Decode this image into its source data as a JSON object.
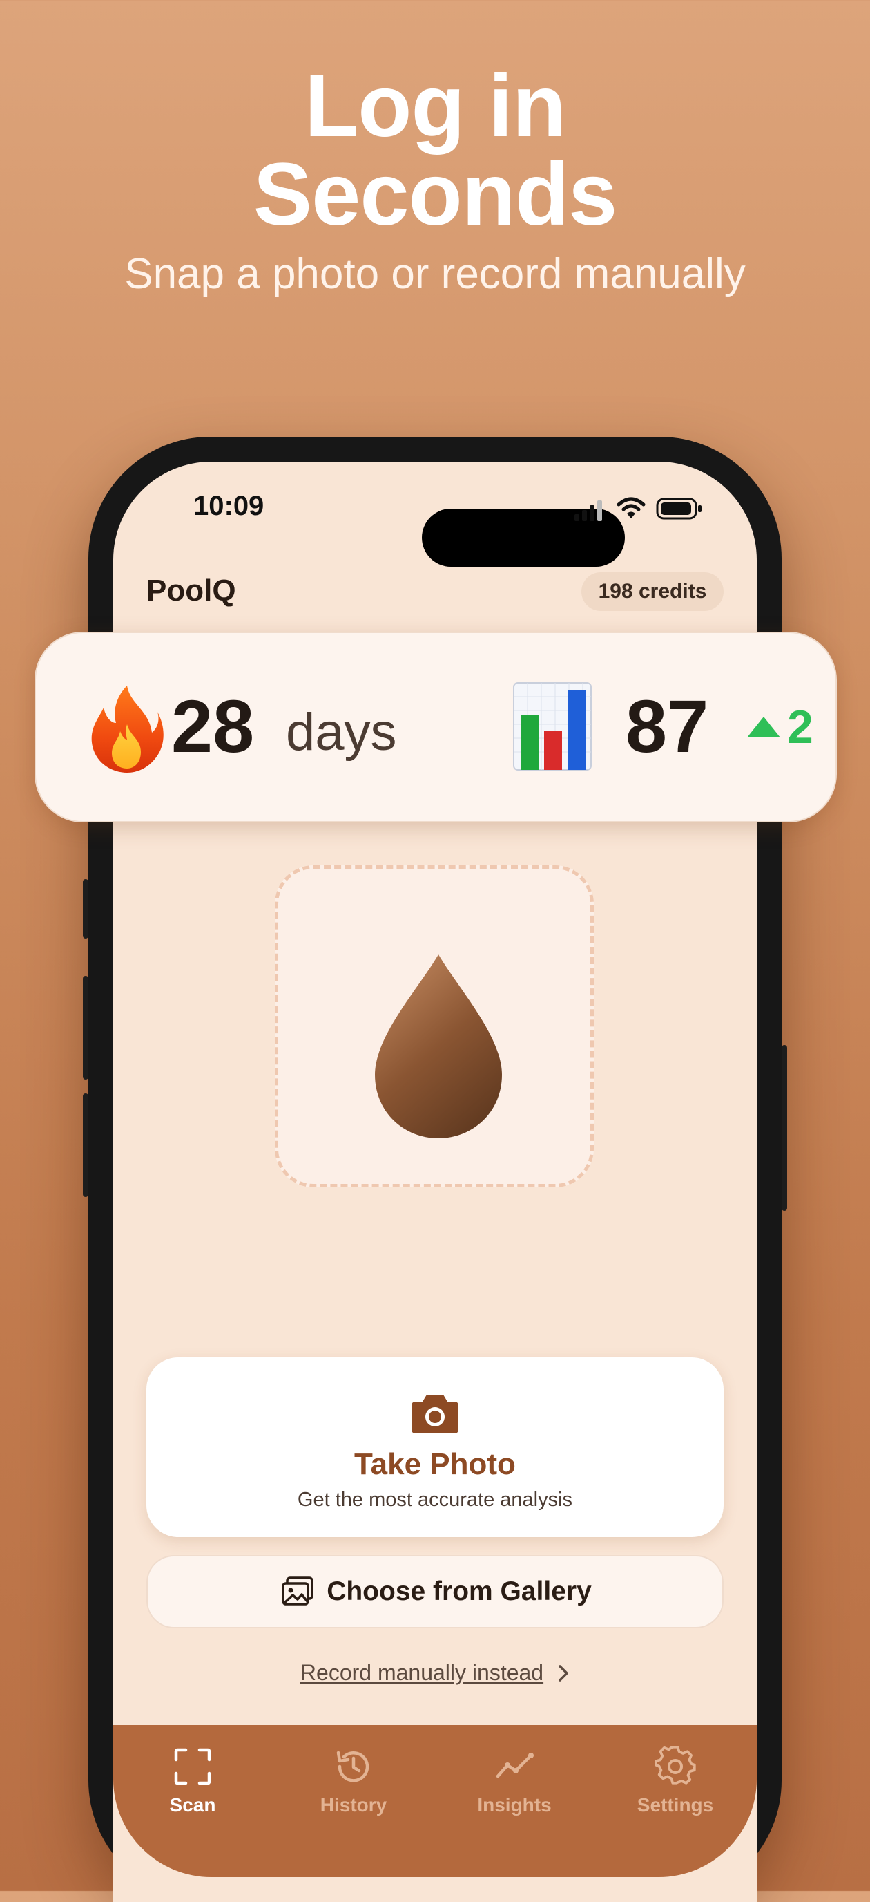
{
  "hero": {
    "title_line1": "Log in",
    "title_line2": "Seconds",
    "subtitle": "Snap a photo or record manually"
  },
  "status_bar": {
    "time": "10:09"
  },
  "app": {
    "title": "PoolQ",
    "credits": "198 credits"
  },
  "stats": {
    "streak_value": "28",
    "streak_unit": "days",
    "streak_icon": "flame-icon",
    "score_value": "87",
    "score_icon": "bar-chart-icon",
    "score_delta": "2"
  },
  "actions": {
    "take_photo_label": "Take Photo",
    "take_photo_sub": "Get the most accurate analysis",
    "gallery_label": "Choose from Gallery",
    "record_label": "Record manually instead"
  },
  "tabs": [
    {
      "label": "Scan",
      "icon": "scan-icon",
      "active": true
    },
    {
      "label": "History",
      "icon": "history-icon",
      "active": false
    },
    {
      "label": "Insights",
      "icon": "insights-icon",
      "active": false
    },
    {
      "label": "Settings",
      "icon": "settings-icon",
      "active": false
    }
  ],
  "colors": {
    "accent": "#8d4a24",
    "tabbar": "#b4693d",
    "positive": "#2fbf57"
  }
}
